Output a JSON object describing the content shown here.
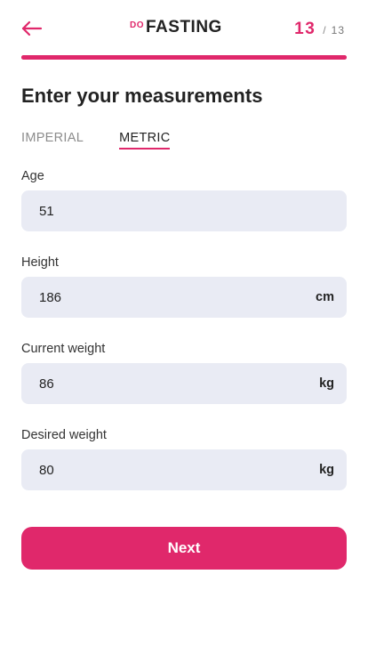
{
  "header": {
    "logo_prefix": "DO",
    "logo_main": "FASTING",
    "step_current": "13",
    "step_separator": "/",
    "step_total": "13",
    "progress_fraction": 1.0,
    "accent_color": "#e0286b"
  },
  "icons": {
    "back": "arrow-left-icon"
  },
  "page": {
    "title": "Enter your measurements"
  },
  "unit_tabs": [
    {
      "label": "IMPERIAL",
      "selected": false
    },
    {
      "label": "METRIC",
      "selected": true
    }
  ],
  "fields": {
    "age": {
      "label": "Age",
      "value": "51",
      "unit": ""
    },
    "height": {
      "label": "Height",
      "value": "186",
      "unit": "cm"
    },
    "current_weight": {
      "label": "Current weight",
      "value": "86",
      "unit": "kg"
    },
    "desired_weight": {
      "label": "Desired weight",
      "value": "80",
      "unit": "kg"
    }
  },
  "next_button": {
    "label": "Next"
  }
}
